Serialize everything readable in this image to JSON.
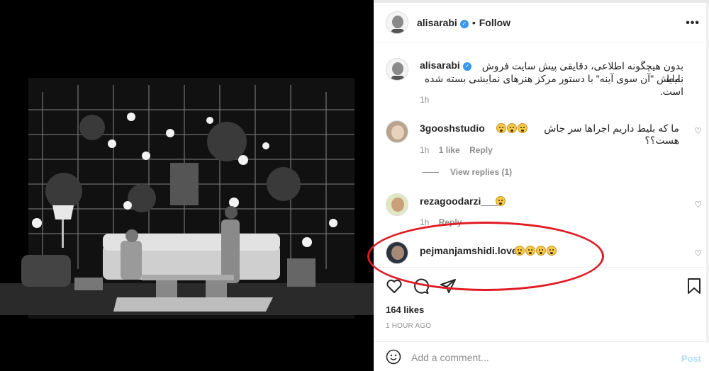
{
  "post": {
    "author": "alisarabi",
    "follow_label": "Follow",
    "dot": "•",
    "more_label": "•••",
    "caption_line1": "بدون هیچگونه اطلاعی، دقایقی پیش سایت فروش بلیط",
    "caption_line2": "نمایش \"آن سوی آینه\" با دستور مرکز هنرهای نمایشی بسته شده است.",
    "caption_time": "1h",
    "likes": "164 likes",
    "time_ago": "1 HOUR AGO"
  },
  "comments": [
    {
      "user": "3gooshstudio",
      "text": "ما که بلیط داریم اجراها سر جاش هست؟؟",
      "emoji_count": 3,
      "time": "1h",
      "likes": "1 like",
      "reply_label": "Reply",
      "view_replies": "View replies (1)"
    },
    {
      "user": "rezagoodarzi___",
      "emoji_count": 1,
      "time": "1h",
      "reply_label": "Reply"
    },
    {
      "user": "pejmanjamshidi.lover",
      "emoji_count": 4
    }
  ],
  "composer": {
    "placeholder": "Add a comment...",
    "post_label": "Post"
  },
  "colors": {
    "verified": "#3897f0",
    "annotation": "#e01b24",
    "post_disabled": "#b2dffc"
  },
  "icons": [
    "verified-badge-icon",
    "more-options-icon",
    "heart-icon",
    "comment-icon",
    "share-icon",
    "bookmark-icon",
    "emoji-icon"
  ]
}
